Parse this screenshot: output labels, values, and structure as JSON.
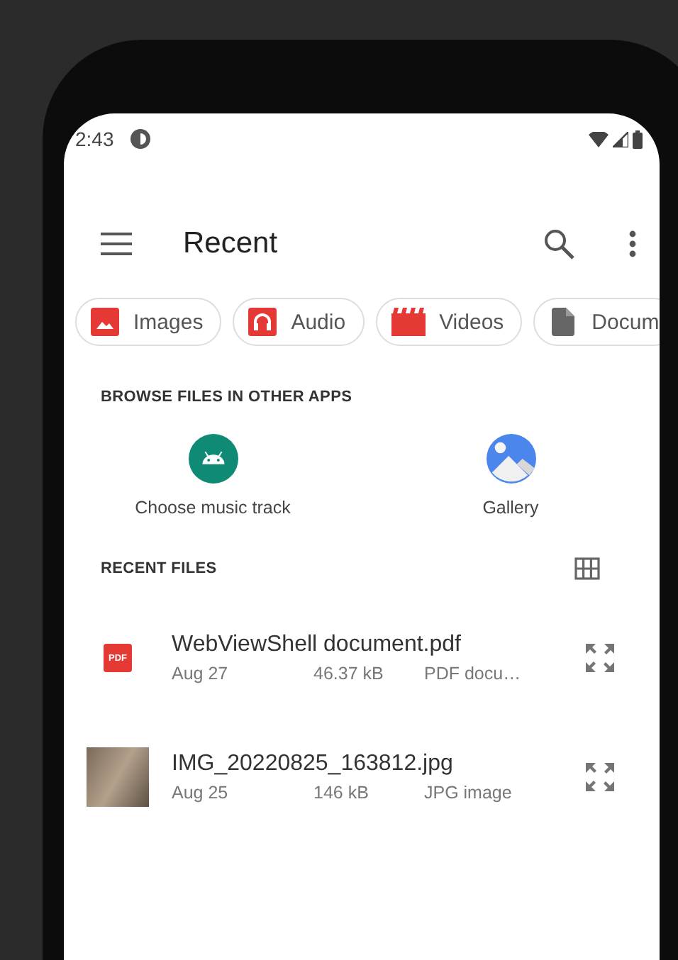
{
  "status_bar": {
    "time": "2:43"
  },
  "toolbar": {
    "title": "Recent"
  },
  "chips": [
    {
      "label": "Images",
      "kind": "images"
    },
    {
      "label": "Audio",
      "kind": "audio"
    },
    {
      "label": "Videos",
      "kind": "videos"
    },
    {
      "label": "Docum",
      "kind": "documents"
    }
  ],
  "browse_section": {
    "heading": "BROWSE FILES IN OTHER APPS",
    "apps": [
      {
        "label": "Choose music track",
        "kind": "android"
      },
      {
        "label": "Gallery",
        "kind": "gallery"
      }
    ]
  },
  "recent_section": {
    "heading": "RECENT FILES",
    "files": [
      {
        "name": "WebViewShell document.pdf",
        "date": "Aug 27",
        "size": "46.37 kB",
        "type": "PDF docu…",
        "kind": "pdf",
        "icon_text": "PDF"
      },
      {
        "name": "IMG_20220825_163812.jpg",
        "date": "Aug 25",
        "size": "146 kB",
        "type": "JPG image",
        "kind": "image"
      }
    ]
  }
}
